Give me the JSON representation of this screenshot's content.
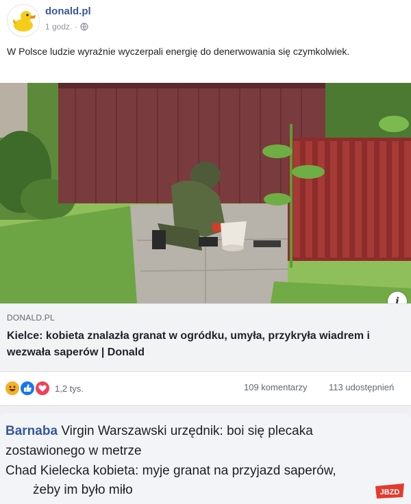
{
  "post": {
    "page_name": "donald.pl",
    "time": "1 godz. ·",
    "text": "W Polsce ludzie wyraźnie wyczerpali energię do denerwowania się czymkolwiek."
  },
  "link": {
    "domain": "DONALD.PL",
    "title": "Kielce: kobieta znalazła granat w ogródku, umyła, przykryła wiadrem i wezwała saperów | Donald"
  },
  "stats": {
    "reactions": "1,2 tys.",
    "comments": "109 komentarzy",
    "shares": "113 udostępnień"
  },
  "comment": {
    "author": "Barnaba",
    "line1": "Virgin Warszawski urzędnik: boi się plecaka",
    "line2": "zostawionego w metrze",
    "line3": "Chad Kielecka kobieta: myje granat na przyjazd saperów,",
    "line4": "żeby im było miło"
  },
  "watermark": "JBZD",
  "colors": {
    "link_blue": "#365899",
    "card_bg": "#f2f3f5",
    "like_blue": "#1877f2",
    "love_red": "#f33e58",
    "haha_yellow": "#f7b125"
  },
  "icons": [
    "duck-avatar-icon",
    "globe-icon",
    "info-icon",
    "haha-reaction-icon",
    "like-reaction-icon",
    "love-reaction-icon"
  ]
}
